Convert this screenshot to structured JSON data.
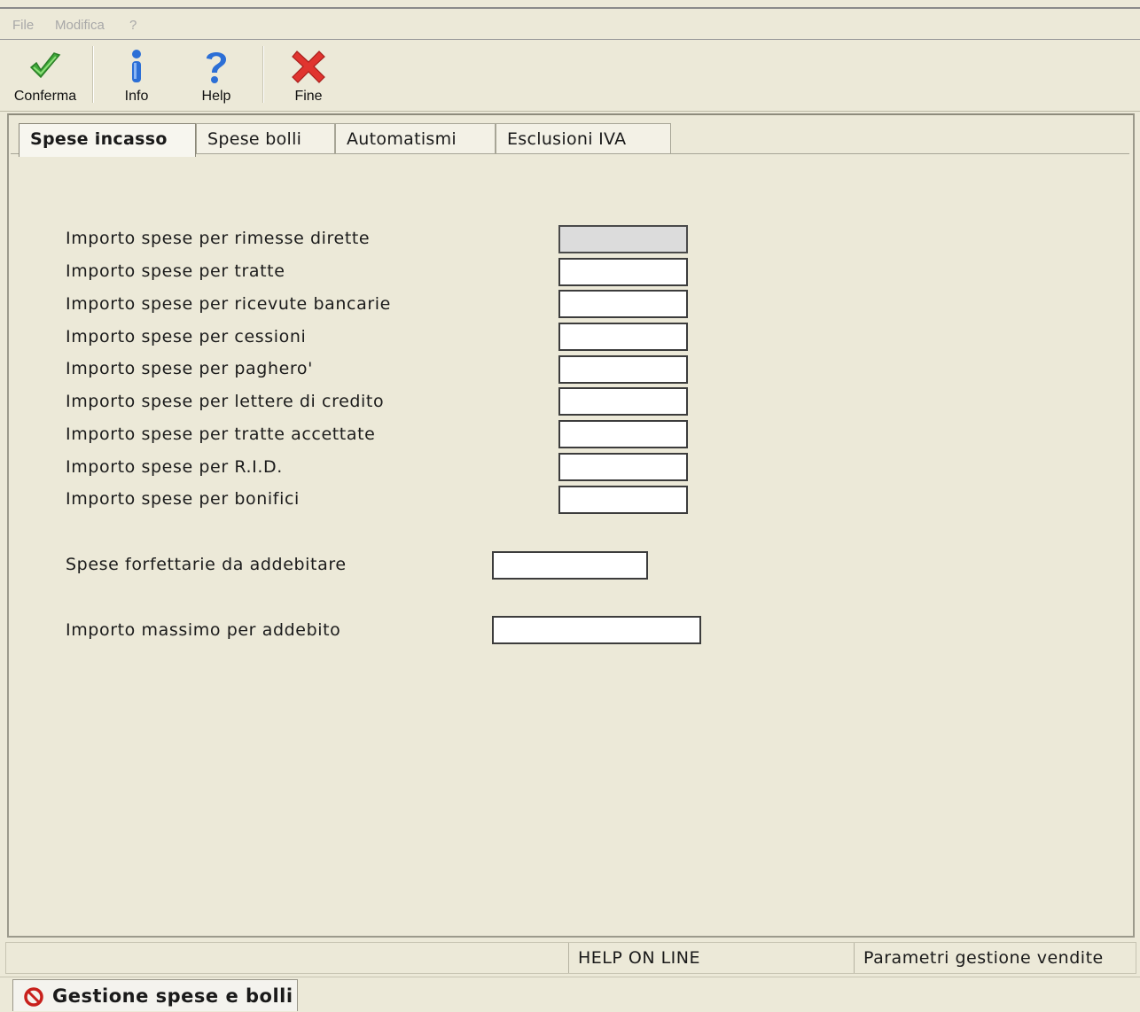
{
  "menu": {
    "items": [
      "File",
      "Modifica",
      "?"
    ]
  },
  "toolbar": {
    "confirm_label": "Conferma",
    "info_label": "Info",
    "help_label": "Help",
    "end_label": "Fine"
  },
  "tabs": [
    {
      "label": "Spese incasso",
      "active": true
    },
    {
      "label": "Spese bolli",
      "active": false
    },
    {
      "label": "Automatismi",
      "active": false
    },
    {
      "label": "Esclusioni IVA",
      "active": false
    }
  ],
  "fields": [
    {
      "label": "Importo spese per rimesse dirette",
      "value": "",
      "disabled": true
    },
    {
      "label": "Importo spese per tratte",
      "value": ""
    },
    {
      "label": "Importo spese per ricevute bancarie",
      "value": ""
    },
    {
      "label": "Importo spese per cessioni",
      "value": ""
    },
    {
      "label": "Importo spese per paghero'",
      "value": ""
    },
    {
      "label": "Importo spese per lettere di credito",
      "value": ""
    },
    {
      "label": "Importo spese per tratte accettate",
      "value": ""
    },
    {
      "label": "Importo spese per R.I.D.",
      "value": ""
    },
    {
      "label": "Importo spese per bonifici",
      "value": ""
    }
  ],
  "forfait": {
    "label": "Spese forfettarie da addebitare",
    "value": ""
  },
  "max_charge": {
    "label": "Importo massimo per addebito",
    "value": ""
  },
  "status": {
    "help": "HELP ON LINE",
    "context": "Parametri gestione vendite"
  },
  "window_tab": {
    "title": "Gestione spese e bolli"
  },
  "colors": {
    "background": "#ece9d8",
    "confirm_green": "#3fa83a",
    "info_blue": "#2c6fd6",
    "end_red": "#e0342f"
  }
}
